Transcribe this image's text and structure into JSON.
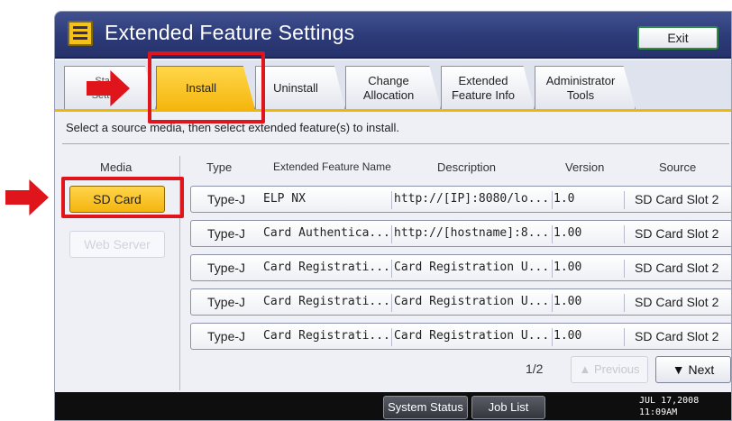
{
  "window": {
    "title": "Extended Feature Settings",
    "icon": "extended-feature-settings-icon",
    "exit_label": "Exit"
  },
  "tabs": [
    {
      "label": "Start\nSett…",
      "active": false
    },
    {
      "label": "Install",
      "active": true
    },
    {
      "label": "Uninstall",
      "active": false
    },
    {
      "label": "Change\nAllocation",
      "active": false
    },
    {
      "label": "Extended\nFeature Info",
      "active": false
    },
    {
      "label": "Administrator\nTools",
      "active": false
    }
  ],
  "instruction": "Select a source media, then select extended feature(s) to install.",
  "columns": {
    "media": "Media",
    "type": "Type",
    "name": "Extended Feature Name",
    "description": "Description",
    "version": "Version",
    "source": "Source"
  },
  "media": {
    "sd_card": "SD Card",
    "web_server": "Web Server"
  },
  "rows": [
    {
      "type": "Type-J",
      "name": "ELP NX",
      "description": "http://[IP]:8080/lo...",
      "version": "1.0",
      "source": "SD Card Slot 2"
    },
    {
      "type": "Type-J",
      "name": "Card Authentica...",
      "description": "http://[hostname]:8...",
      "version": "1.00",
      "source": "SD Card Slot 2"
    },
    {
      "type": "Type-J",
      "name": "Card Registrati...",
      "description": "Card Registration U...",
      "version": "1.00",
      "source": "SD Card Slot 2"
    },
    {
      "type": "Type-J",
      "name": "Card Registrati...",
      "description": "Card Registration U...",
      "version": "1.00",
      "source": "SD Card Slot 2"
    },
    {
      "type": "Type-J",
      "name": "Card Registrati...",
      "description": "Card Registration U...",
      "version": "1.00",
      "source": "SD Card Slot 2"
    }
  ],
  "pagination": {
    "page": "1/2",
    "previous_label": "▲ Previous",
    "next_label": "▼ Next"
  },
  "bottombar": {
    "system_status": "System Status",
    "job_list": "Job List",
    "date": "JUL  17,2008",
    "time": "11:09AM"
  },
  "colors": {
    "accent_yellow": "#f5b70f",
    "title_blue": "#2c3a78",
    "highlight_red": "#e0141b"
  }
}
